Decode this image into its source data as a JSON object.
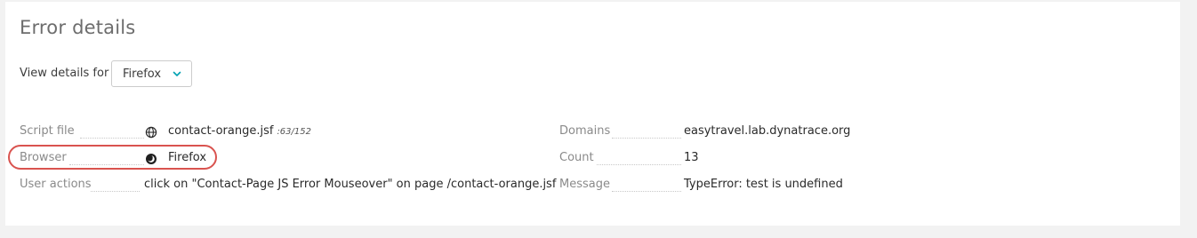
{
  "header": {
    "title": "Error details"
  },
  "view_details": {
    "label": "View details for",
    "selected": "Firefox"
  },
  "details_left": {
    "script_file": {
      "label": "Script file",
      "value": "contact-orange.jsf",
      "position": ":63/152"
    },
    "browser": {
      "label": "Browser",
      "value": "Firefox"
    },
    "user_actions": {
      "label": "User actions",
      "value": "click on \"Contact-Page JS Error Mouseover\" on page /contact-orange.jsf"
    }
  },
  "details_right": {
    "domains": {
      "label": "Domains",
      "value": "easytravel.lab.dynatrace.org"
    },
    "count": {
      "label": "Count",
      "value": "13"
    },
    "message": {
      "label": "Message",
      "value": "TypeError: test is undefined"
    }
  },
  "colors": {
    "accent": "#00a1b2",
    "highlight": "#d9534f"
  },
  "icons": {
    "script_file": "globe-icon",
    "browser": "firefox-icon",
    "select": "chevron-down-icon"
  }
}
